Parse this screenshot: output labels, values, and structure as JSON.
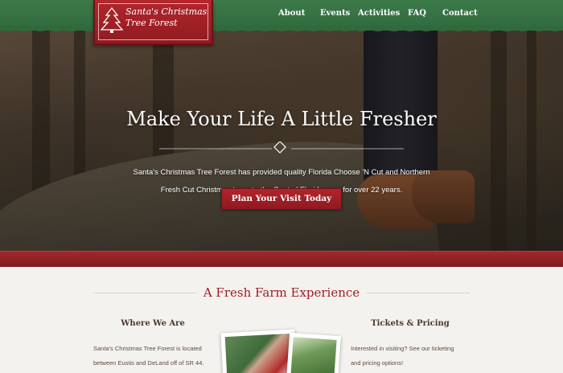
{
  "logo": {
    "line1": "Santa's Christmas",
    "line2": "Tree Forest",
    "icon": "christmas-tree-icon"
  },
  "nav": {
    "items": [
      {
        "label": "About"
      },
      {
        "label": "Events"
      },
      {
        "label": "Activities"
      },
      {
        "label": "FAQ"
      },
      {
        "label": "Contact"
      }
    ]
  },
  "hero": {
    "title": "Make Your Life A Little Fresher",
    "text_line1": "Santa's Christmas Tree Forest has provided quality Florida Choose 'N Cut and Northern",
    "text_line2": "Fresh Cut Christmas trees to the Central Florida area for over 22 years.",
    "cta": "Plan Your Visit Today"
  },
  "section": {
    "title": "A Fresh Farm Experience",
    "where": {
      "title": "Where We Are",
      "line1": "Santa's Christmas Tree Forest is located",
      "line2": "between Eustis and DeLand off of SR 44."
    },
    "tickets": {
      "title": "Tickets & Pricing",
      "line1": "Interested in visiting? See our ticketing",
      "line2": "and pricing options!"
    }
  },
  "colors": {
    "header_green": "#3d7a4a",
    "brand_red": "#9c1f26",
    "background": "#f4f2ee"
  }
}
